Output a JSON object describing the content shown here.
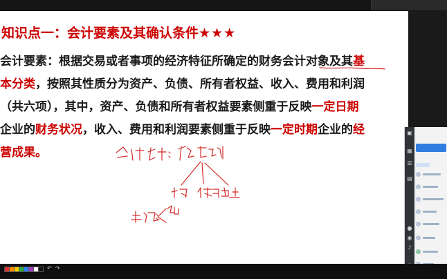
{
  "slide": {
    "title": "知识点一：会计要素及其确认条件",
    "stars": "★★★",
    "lines": [
      {
        "segments": [
          {
            "text": "会计要素：根据交易或者事项的经济特征所确定的财务会计对象及其",
            "style": "normal"
          },
          {
            "text": "基",
            "style": "red"
          }
        ]
      },
      {
        "segments": [
          {
            "text": "本分类",
            "style": "red"
          },
          {
            "text": "，按照其性质分为资产、负债、所有者权益、收入、费用和利润",
            "style": "normal"
          }
        ]
      },
      {
        "segments": [
          {
            "text": "（共六项），其中，资产、负债和所有者权益要素侧重于反映",
            "style": "normal"
          },
          {
            "text": "一定日期",
            "style": "red"
          }
        ]
      },
      {
        "segments": [
          {
            "text": "企业的",
            "style": "normal"
          },
          {
            "text": "财务状况",
            "style": "red"
          },
          {
            "text": "，收入、费用和利润要素侧重于反映",
            "style": "normal"
          },
          {
            "text": "一定时期",
            "style": "red"
          },
          {
            "text": "企业的",
            "style": "normal"
          },
          {
            "text": "经",
            "style": "red"
          }
        ]
      },
      {
        "segments": [
          {
            "text": "营成果。",
            "style": "red"
          }
        ]
      }
    ]
  },
  "annotations": {
    "ink_color": "#d42a2a",
    "notes": [
      "会计对象：资金运动",
      "投入",
      "使用",
      "退出",
      "来源：",
      "运用"
    ]
  },
  "side_panel": {
    "icons": [
      "share-icon",
      "grid-icon",
      "list-icon",
      "file-icon",
      "mic-icon",
      "camera-icon",
      "music-icon",
      "settings-icon"
    ]
  },
  "bottom_toolbar": {
    "swatches": [
      "#e03030",
      "#ff8800",
      "#ffd000",
      "#30b040",
      "#3080ff",
      "#a040c0",
      "#ffffff",
      "#111111"
    ]
  },
  "colors": {
    "title_red": "#cc0000",
    "body": "#1a1a1a",
    "accent_blue": "#2f7de1"
  }
}
